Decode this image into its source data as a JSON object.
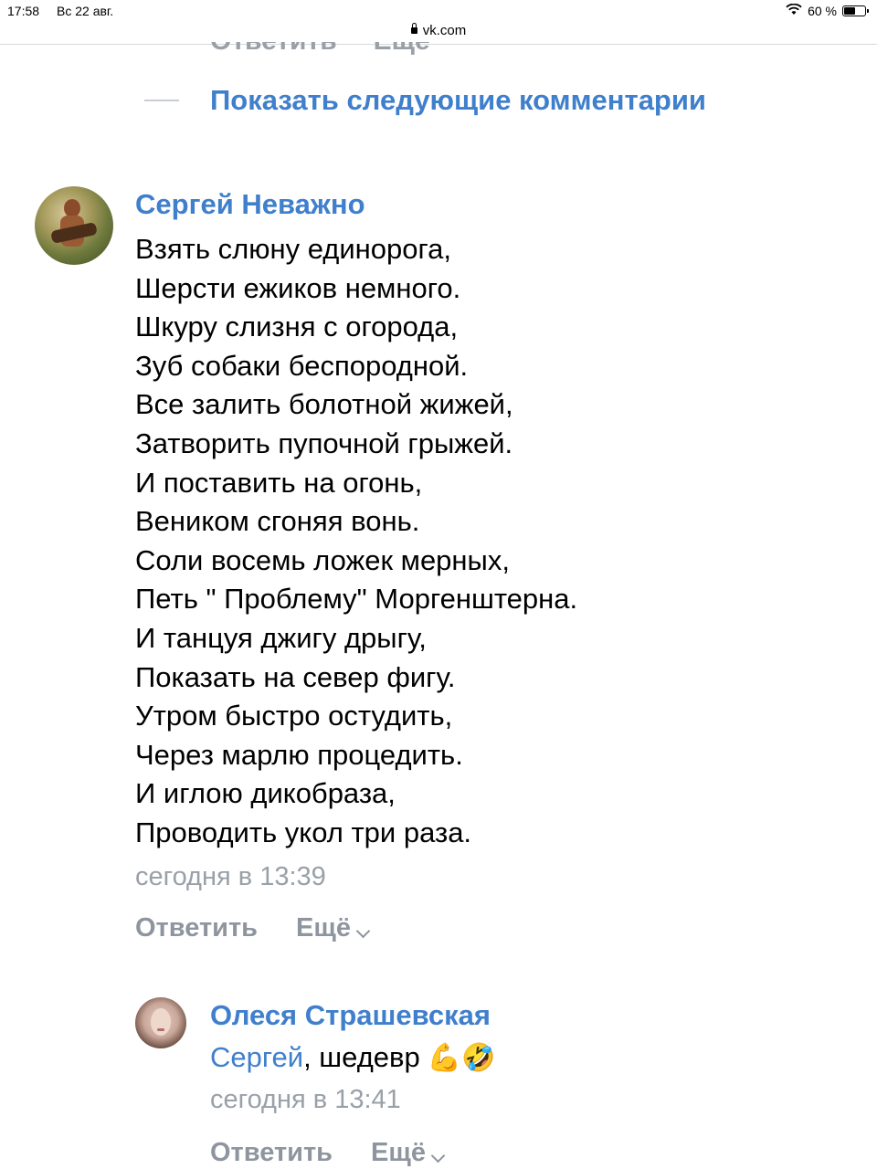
{
  "status_bar": {
    "time": "17:58",
    "date": "Вс 22 авг.",
    "battery": "60 %"
  },
  "browser": {
    "url": "vk.com"
  },
  "previous_actions": {
    "reply": "Ответить",
    "more": "Ещё"
  },
  "show_more": {
    "label": "Показать следующие комментарии"
  },
  "comments": [
    {
      "author": "Сергей Неважно",
      "lines": [
        "Взять слюну единорога,",
        "Шерсти ежиков немного.",
        "Шкуру слизня с огорода,",
        "Зуб собаки беспородной.",
        "Все залить болотной жижей,",
        "Затворить пупочной грыжей.",
        "И поставить на огонь,",
        "Веником сгоняя вонь.",
        "Соли восемь ложек мерных,",
        "Петь \" Проблему\" Моргенштерна.",
        "И танцуя джигу дрыгу,",
        "Показать на север фигу.",
        "Утром быстро остудить,",
        "Через марлю процедить.",
        "И иглою дикобраза,",
        "Проводить укол три раза."
      ],
      "time": "сегодня в 13:39",
      "reply_label": "Ответить",
      "more_label": "Ещё"
    }
  ],
  "reply": {
    "author": "Олеся Страшевская",
    "mention": "Сергей",
    "text": ", шедевр",
    "emojis": "💪🤣",
    "time": "сегодня в 13:41",
    "reply_label": "Ответить",
    "more_label": "Ещё"
  }
}
